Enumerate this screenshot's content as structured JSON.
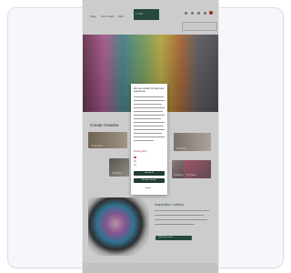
{
  "header": {
    "logo_text": "LYRA",
    "nav": [
      "Shop",
      "Art & Craft",
      "Kids"
    ],
    "search_placeholder": ""
  },
  "sections": {
    "creative_title": "Create Creative",
    "tiles": [
      "Colouring",
      "Drawing",
      "Painting",
      "Crafting",
      "Art Sets"
    ],
    "feature_title": "Inspiration Gallery",
    "feature_button": "Discover now"
  },
  "modal": {
    "title": "We use cookies for best user experience",
    "link": "Privacy policy",
    "accept_all": "Accept all",
    "accept_selected": "Accept selected",
    "reject": "Reject"
  },
  "colors": {
    "brand_green": "#2f5c4f",
    "dark_green": "#1f3d34"
  }
}
